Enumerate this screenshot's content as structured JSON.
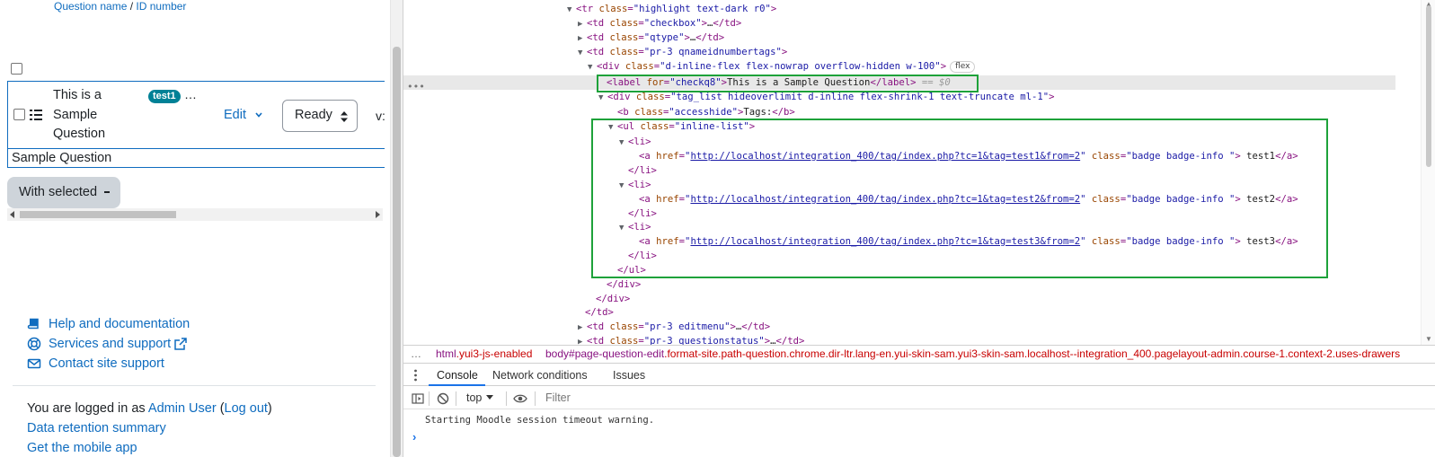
{
  "page": {
    "column_header": {
      "name": "Question name",
      "sep": " / ",
      "id": "ID number"
    },
    "question": {
      "title": "This is a Sample Question",
      "tag": "test1",
      "tag_more": "…",
      "edit_label": "Edit",
      "status_value": "Ready",
      "version_cut": "v:",
      "label_text": "Sample Question"
    },
    "with_selected": "With selected",
    "footer": {
      "help": "Help and documentation",
      "services": "Services and support",
      "contact": "Contact site support",
      "logged_prefix": "You are logged in as ",
      "user": "Admin User",
      "open_paren": " (",
      "logout": "Log out",
      "close_paren": ")",
      "data_retention": "Data retention summary",
      "mobile_app": "Get the mobile app"
    }
  },
  "devtools": {
    "lines": {
      "tr_tag": "<tr ",
      "tr_class_attr": "class",
      "tr_class_val": "\"highlight text-dark r0\"",
      "td_checkbox_val": "\"checkbox\"",
      "td_qtype_val": "\"qtype\"",
      "td_tags_val": "\"pr-3 qnameidnumbertags\"",
      "div_class_val": "\"d-inline-flex flex-nowrap overflow-hidden w-100\"",
      "flex_badge": "flex",
      "label_for_val": "\"checkq8\"",
      "label_text": "This is a Sample Question",
      "selected_marker": " == $0",
      "taglist_class_val": "\"tag_list hideoverlimit d-inline flex-shrink-1 text-truncate ml-1\"",
      "b_class_val": "\"accesshide\"",
      "b_text": "Tags:",
      "ul_class_val": "\"inline-list\"",
      "href1": "http://localhost/integration_400/tag/index.php?tc=1&tag=test1&from=2",
      "href2": "http://localhost/integration_400/tag/index.php?tc=1&tag=test2&from=2",
      "href3": "http://localhost/integration_400/tag/index.php?tc=1&tag=test3&from=2",
      "badge_class_val": "\"badge badge-info \"",
      "tag1": " test1",
      "tag2": " test2",
      "tag3": " test3",
      "td_editmenu_val": "\"pr-3 editmenu\"",
      "td_status_val": "\"pr-3 questionstatus\""
    },
    "breadcrumb": {
      "item1_tag": "html",
      "item1_class": ".yui3-js-enabled",
      "item2_tag": "body",
      "item2_id": "#page-question-edit",
      "item2_class": ".format-site.path-question.chrome.dir-ltr.lang-en.yui-skin-sam.yui3-skin-sam.localhost--integration_400.pagelayout-admin.course-1.context-2.uses-drawers"
    },
    "drawer_tabs": [
      "Console",
      "Network conditions",
      "Issues"
    ],
    "context": "top",
    "filter_placeholder": "Filter",
    "console_message": "Starting Moodle session timeout warning.",
    "prompt": "›"
  }
}
